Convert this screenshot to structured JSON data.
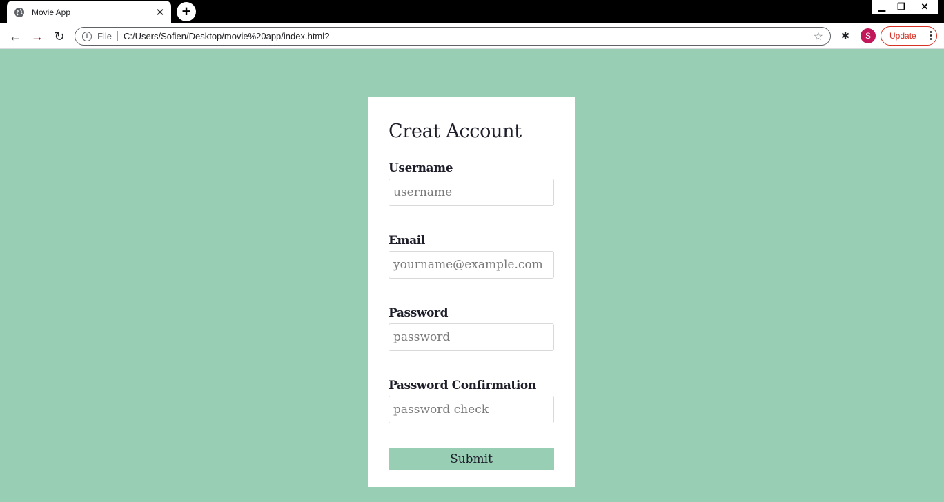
{
  "browser": {
    "tab_title": "Movie App",
    "omnibox_scheme": "File",
    "url": "C:/Users/Sofien/Desktop/movie%20app/index.html?",
    "profile_initial": "S",
    "update_label": "Update"
  },
  "form": {
    "title": "Creat Account",
    "fields": [
      {
        "label": "Username",
        "placeholder": "username"
      },
      {
        "label": "Email",
        "placeholder": "yourname@example.com"
      },
      {
        "label": "Password",
        "placeholder": "password"
      },
      {
        "label": "Password Confirmation",
        "placeholder": "password check"
      }
    ],
    "submit_label": "Submit"
  },
  "colors": {
    "page_background": "#98cfb4",
    "submit_background": "#98cfb4",
    "profile_avatar": "#c2185b",
    "update_accent": "#d93025"
  }
}
